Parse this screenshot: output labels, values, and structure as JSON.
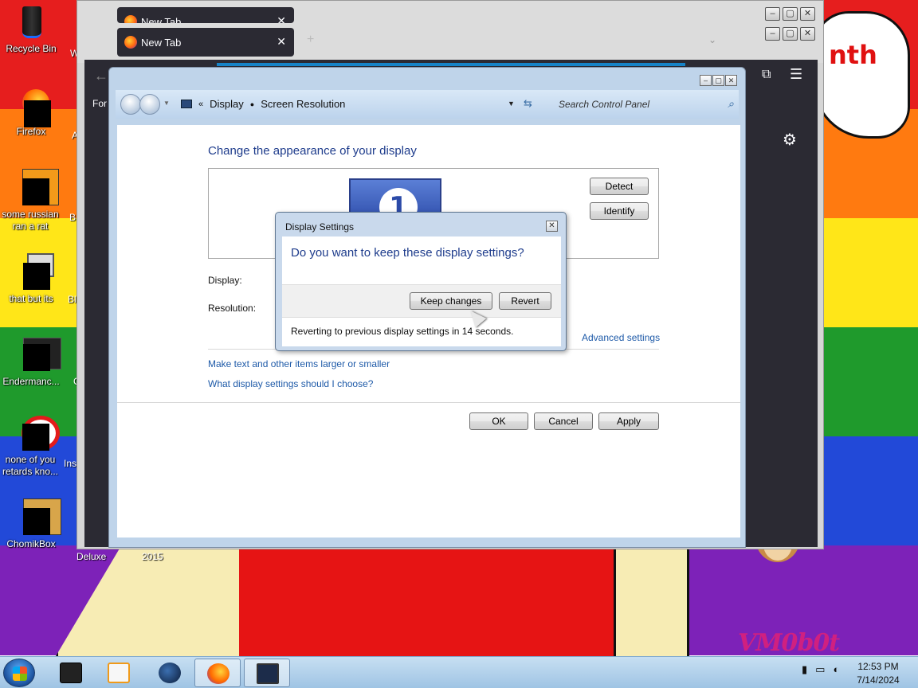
{
  "desktop": {
    "icons": [
      {
        "label": "Recycle Bin",
        "icon": "recycle-bin-icon"
      },
      {
        "label": "Firefox",
        "icon": "firefox-icon"
      },
      {
        "label": "some russian ran a rat",
        "icon": "shortcut-icon"
      },
      {
        "label": "that but its",
        "icon": "shortcut-icon"
      },
      {
        "label": "Endermanc...",
        "icon": "shortcut-icon"
      },
      {
        "label": "none of you retards kno...",
        "icon": "shortcut-icon"
      },
      {
        "label": "ChomikBox",
        "icon": "chomikbox-icon"
      }
    ],
    "column2": [
      "W\nL",
      "A",
      "B",
      "Bl",
      "C",
      "Ins",
      "Deluxe",
      "2015"
    ],
    "wallpaper_text": "nth",
    "watermark": "VM0b0t"
  },
  "browser": {
    "tabs": [
      {
        "label": "New Tab"
      },
      {
        "label": "New Tab"
      }
    ],
    "toolbar_label": "For c"
  },
  "control_panel": {
    "breadcrumb": [
      "Display",
      "Screen Resolution"
    ],
    "search_placeholder": "Search Control Panel",
    "heading": "Change the appearance of your display",
    "monitor_number": "1",
    "detect_label": "Detect",
    "identify_label": "Identify",
    "display_label": "Display:",
    "resolution_label": "Resolution:",
    "advanced_link": "Advanced settings",
    "link_text_size": "Make text and other items larger or smaller",
    "link_choose": "What display settings should I choose?",
    "ok_label": "OK",
    "cancel_label": "Cancel",
    "apply_label": "Apply"
  },
  "dialog": {
    "title": "Display Settings",
    "question": "Do you want to keep these display settings?",
    "keep_label": "Keep changes",
    "revert_label": "Revert",
    "footer": "Reverting to previous display settings in 14 seconds."
  },
  "taskbar": {
    "items": [
      {
        "icon": "app-icon"
      },
      {
        "icon": "media-player-icon"
      },
      {
        "icon": "globe-icon"
      },
      {
        "icon": "firefox-icon"
      },
      {
        "icon": "display-settings-icon"
      }
    ],
    "time": "12:53 PM",
    "date": "7/14/2024"
  },
  "colors": {
    "accent_blue": "#1e3c8c",
    "link_blue": "#1e5aa8",
    "taskbar": "#b3d2ec"
  }
}
